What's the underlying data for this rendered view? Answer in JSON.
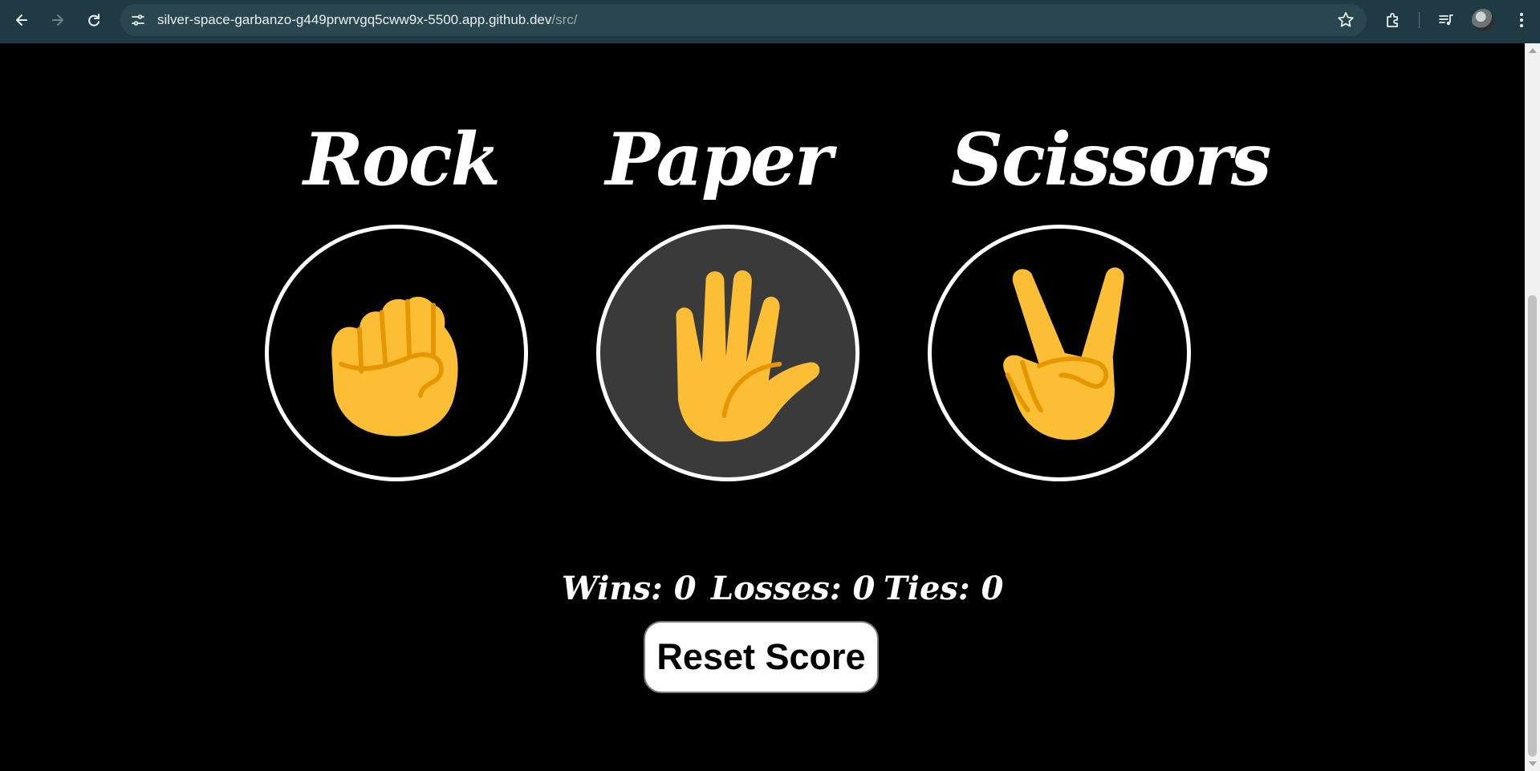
{
  "browser": {
    "url_host": "silver-space-garbanzo-g449prwrvgq5cww9x-5500.app.github.dev",
    "url_path": "/src/"
  },
  "game": {
    "choices": [
      {
        "label": "Rock",
        "icon": "raised-fist-icon",
        "selected": false
      },
      {
        "label": "Paper",
        "icon": "raised-hand-icon",
        "selected": true
      },
      {
        "label": "Scissors",
        "icon": "victory-hand-icon",
        "selected": false
      }
    ],
    "score": {
      "wins_label": "Wins:",
      "wins": "0",
      "losses_label": "Losses:",
      "losses": "0",
      "ties_label": "Ties:",
      "ties": "0"
    },
    "reset_label": "Reset Score"
  },
  "colors": {
    "background": "#000000",
    "emoji_skin": "#fbbe35",
    "emoji_line": "#e59600",
    "selected_bg": "#3b3a3b",
    "chrome": "#1f3a42"
  }
}
